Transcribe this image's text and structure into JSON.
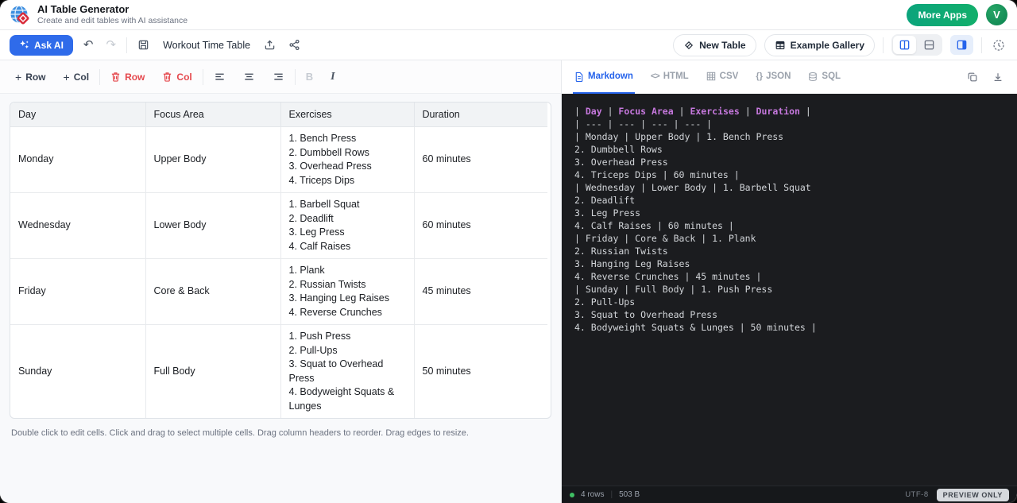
{
  "header": {
    "app_title": "AI Table Generator",
    "app_subtitle": "Create and edit tables with AI assistance",
    "more_apps_label": "More Apps",
    "avatar_initial": "V"
  },
  "toolbar": {
    "ask_ai_label": "Ask AI",
    "doc_title": "Workout Time Table",
    "new_table_label": "New Table",
    "example_gallery_label": "Example Gallery"
  },
  "table_toolbar": {
    "add_row_label": "Row",
    "add_col_label": "Col",
    "delete_row_label": "Row",
    "delete_col_label": "Col"
  },
  "table": {
    "columns": [
      "Day",
      "Focus Area",
      "Exercises",
      "Duration"
    ],
    "rows": [
      {
        "day": "Monday",
        "focus_area": "Upper Body",
        "exercises": [
          "1. Bench Press",
          "2. Dumbbell Rows",
          "3. Overhead Press",
          "4. Triceps Dips"
        ],
        "duration": "60 minutes"
      },
      {
        "day": "Wednesday",
        "focus_area": "Lower Body",
        "exercises": [
          "1. Barbell Squat",
          "2. Deadlift",
          "3. Leg Press",
          "4. Calf Raises"
        ],
        "duration": "60 minutes"
      },
      {
        "day": "Friday",
        "focus_area": "Core & Back",
        "exercises": [
          "1. Plank",
          "2. Russian Twists",
          "3. Hanging Leg Raises",
          "4. Reverse Crunches"
        ],
        "duration": "45 minutes"
      },
      {
        "day": "Sunday",
        "focus_area": "Full Body",
        "exercises": [
          "1. Push Press",
          "2. Pull-Ups",
          "3. Squat to Overhead Press",
          "4. Bodyweight Squats & Lunges"
        ],
        "duration": "50 minutes"
      }
    ],
    "help_text": "Double click to edit cells. Click and drag to select multiple cells. Drag column headers to reorder. Drag edges to resize."
  },
  "export_panel": {
    "tabs": [
      {
        "label": "Markdown",
        "active": true
      },
      {
        "label": "HTML",
        "active": false
      },
      {
        "label": "CSV",
        "active": false
      },
      {
        "label": "JSON",
        "active": false
      },
      {
        "label": "SQL",
        "active": false
      }
    ],
    "markdown": {
      "header_cells": [
        "Day",
        "Focus Area",
        "Exercises",
        "Duration"
      ],
      "separator_line": "| --- | --- | --- | --- |",
      "body_lines": [
        "| Monday | Upper Body | 1. Bench Press",
        "2. Dumbbell Rows",
        "3. Overhead Press",
        "4. Triceps Dips | 60 minutes |",
        "| Wednesday | Lower Body | 1. Barbell Squat",
        "2. Deadlift",
        "3. Leg Press",
        "4. Calf Raises | 60 minutes |",
        "| Friday | Core & Back | 1. Plank",
        "2. Russian Twists",
        "3. Hanging Leg Raises",
        "4. Reverse Crunches | 45 minutes |",
        "| Sunday | Full Body | 1. Push Press",
        "2. Pull-Ups",
        "3. Squat to Overhead Press",
        "4. Bodyweight Squats & Lunges | 50 minutes |"
      ]
    },
    "status": {
      "row_count": "4 rows",
      "divider": "|",
      "size": "503 B",
      "encoding": "UTF-8",
      "badge": "PREVIEW ONLY"
    }
  },
  "icons": {
    "plus-icon": "+",
    "undo-icon": "↶",
    "redo-icon": "↷",
    "bold-icon": "B",
    "italic-icon": "I",
    "html-tab-icon": "<>",
    "json-tab-icon": "{ }"
  },
  "colors": {
    "accent_blue": "#2563eb",
    "ask_ai_blue": "#2f6bea",
    "danger_red": "#e5484d",
    "more_apps_teal": "#0ba47c",
    "avatar_green": "#0c8350",
    "code_background": "#1b1c1f",
    "code_header_magenta": "#c678dd",
    "code_text": "#d3d6da",
    "status_green_dot": "#3fbf63"
  }
}
